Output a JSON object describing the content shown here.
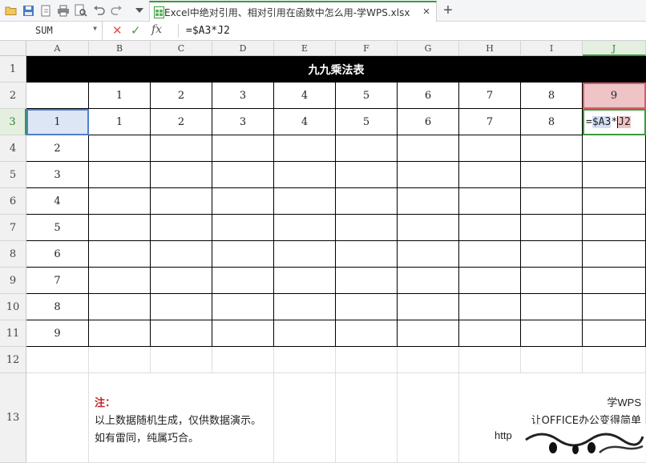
{
  "document_tab": {
    "title": "Excel中绝对引用、相对引用在函数中怎么用-学WPS.xlsx",
    "close": "×",
    "new_tab": "+"
  },
  "toolbar_icons": [
    "open-folder-icon",
    "save-icon",
    "export-icon",
    "print-icon",
    "print-preview-icon",
    "undo-icon",
    "redo-icon",
    "dropdown-arrow-icon",
    "spreadsheet-file-icon"
  ],
  "formula_bar": {
    "name_box": "SUM",
    "cancel": "✕",
    "enter": "✓",
    "fx": "fx",
    "formula": "=$A3*J2"
  },
  "columns": [
    "A",
    "B",
    "C",
    "D",
    "E",
    "F",
    "G",
    "H",
    "I",
    "J"
  ],
  "rows": [
    "1",
    "2",
    "3",
    "4",
    "5",
    "6",
    "7",
    "8",
    "9",
    "10",
    "11",
    "12",
    "13"
  ],
  "selected_column": "J",
  "selected_row": "3",
  "sheet": {
    "title": "九九乘法表",
    "row2": [
      "",
      "1",
      "2",
      "3",
      "4",
      "5",
      "6",
      "7",
      "8",
      "9"
    ],
    "row3": [
      "1",
      "1",
      "2",
      "3",
      "4",
      "5",
      "6",
      "7",
      "8"
    ],
    "column_a": [
      "2",
      "3",
      "4",
      "5",
      "6",
      "7",
      "8",
      "9"
    ],
    "editing_cell": {
      "prefix": "=",
      "ref1": "$A3",
      "op": "*",
      "ref2": "J2"
    }
  },
  "note": {
    "title": "注：",
    "line1": "以上数据随机生成，仅供数据演示。",
    "line2": "如有雷同，纯属巧合。"
  },
  "brand": {
    "name": "学WPS",
    "slogan": "让OFFICE办公变得简单",
    "url": "http"
  },
  "colors": {
    "title_bg": "#000000",
    "ref_a3": "#4f7ed1",
    "ref_j2": "#d85b68",
    "active_green": "#3a9a3a",
    "note_red": "#c0262d"
  }
}
